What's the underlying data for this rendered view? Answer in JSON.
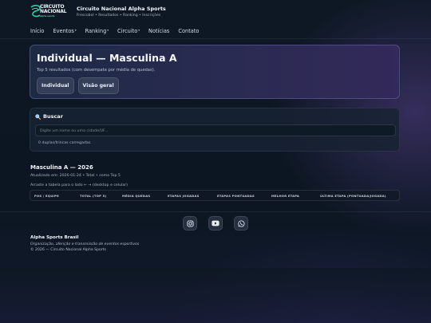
{
  "brand": {
    "logo_line1": "CIRCUITO",
    "logo_line2": "NACIONAL",
    "logo_line3": "alpha sports",
    "title": "Circuito Nacional Alpha Sports",
    "subtitle": "Frescobol • Resultados • Ranking • Inscrições"
  },
  "nav": {
    "items": [
      {
        "label": "Início"
      },
      {
        "label": "Eventos",
        "caret": "▾"
      },
      {
        "label": "Ranking",
        "caret": "▾"
      },
      {
        "label": "Circuito",
        "caret": "▾"
      },
      {
        "label": "Notícias"
      },
      {
        "label": "Contato"
      }
    ]
  },
  "hero": {
    "title": "Individual — Masculina A",
    "subtitle": "Top 5 resultados (com desempate por média de quedas).",
    "buttons": [
      "Individual",
      "Visão geral"
    ]
  },
  "search": {
    "title": "Buscar",
    "placeholder": "Digite um nome ou uma cidade/UF...",
    "status": "0 duplas/trincas carregadas."
  },
  "table": {
    "title": "Masculina A — 2026",
    "updated": "Atualizado em: 2026-01-24 • Total • soma Top 5",
    "hint": "Arraste a tabela para o lado ← → (desktop e celular)",
    "columns": [
      "POS / EQUIPE",
      "TOTAL (TOP 5)",
      "MÉDIA QUEDAS",
      "ETAPAS JOGADAS",
      "ETAPAS PONTUADAS",
      "MELHOR ETAPA",
      "ÚLTIMA ETAPA (PONTUADA/JOGADA)"
    ]
  },
  "footer": {
    "social": [
      "instagram-icon",
      "youtube-icon",
      "whatsapp-icon"
    ],
    "name": "Alpha Sports Brasil",
    "description": "Organização, aferição e transmissão de eventos esportivos",
    "copyright": "© 2026 — Circuito Nacional Alpha Sports"
  },
  "colors": {
    "background": "#0b1420",
    "hero_start": "#1d2a44",
    "hero_end": "#33295a",
    "logo_accent": "#2ad1a3"
  }
}
